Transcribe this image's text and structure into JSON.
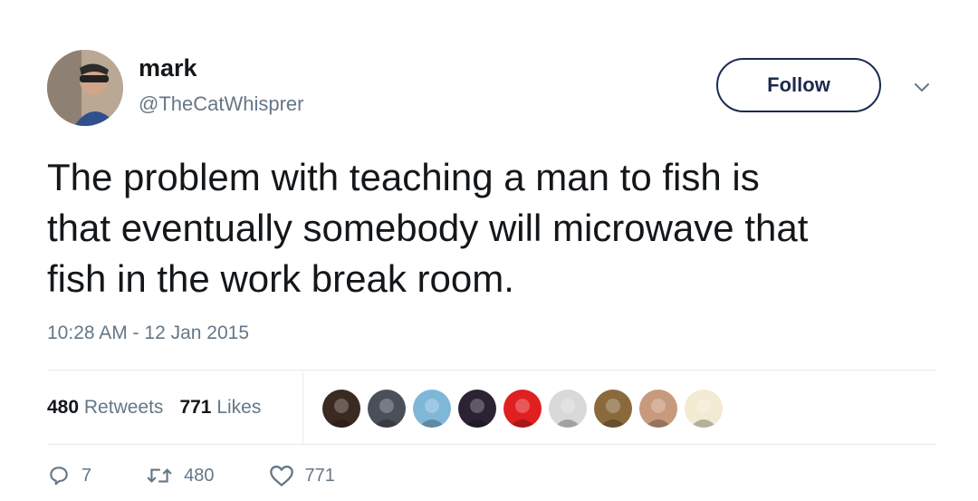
{
  "user": {
    "name": "mark",
    "handle": "@TheCatWhisprer"
  },
  "follow_label": "Follow",
  "tweet_text": "The problem with teaching a man to fish is\nthat eventually somebody will microwave that\nfish in the work break room.",
  "timestamp": "10:28 AM - 12 Jan 2015",
  "stats": {
    "retweets_count": "480",
    "retweets_label": "Retweets",
    "likes_count": "771",
    "likes_label": "Likes"
  },
  "likers": [
    {
      "color": "#3b2a22"
    },
    {
      "color": "#4a4f5a"
    },
    {
      "color": "#7fb7d8"
    },
    {
      "color": "#2b2333"
    },
    {
      "color": "#e02020"
    },
    {
      "color": "#d9d9d9"
    },
    {
      "color": "#8a6a3c"
    },
    {
      "color": "#c79a7e"
    },
    {
      "color": "#f3ead2"
    }
  ],
  "actions": {
    "replies": "7",
    "retweets": "480",
    "likes": "771"
  },
  "icons": {
    "reply": "reply-icon",
    "retweet": "retweet-icon",
    "like": "heart-icon",
    "caret": "chevron-down-icon"
  }
}
